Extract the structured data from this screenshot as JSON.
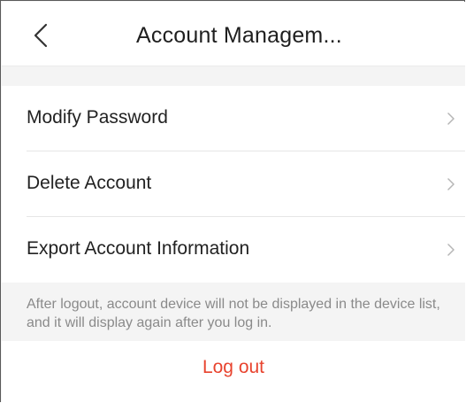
{
  "header": {
    "title": "Account Managem...",
    "back_icon": "chevron-left-icon"
  },
  "menu": {
    "items": [
      {
        "label": "Modify Password",
        "icon": "chevron-right-icon"
      },
      {
        "label": "Delete Account",
        "icon": "chevron-right-icon"
      },
      {
        "label": "Export Account Information",
        "icon": "chevron-right-icon"
      }
    ]
  },
  "note": {
    "text": "After logout, account device will not be displayed in the device list, and it will display again after you log in."
  },
  "logout": {
    "label": "Log out",
    "color": "#e8432e"
  }
}
